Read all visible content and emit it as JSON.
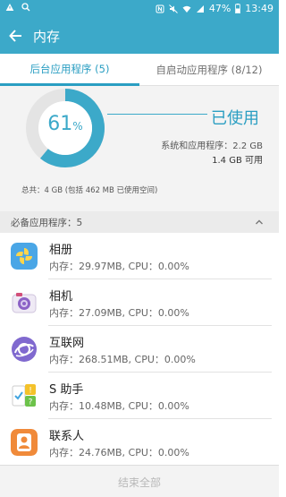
{
  "status_bar": {
    "battery": "47%",
    "time": "13:49",
    "left_icons": [
      "warning-icon",
      "search-icon"
    ],
    "right_icons": [
      "nfc-icon",
      "mute-icon",
      "wifi-icon",
      "signal-icon",
      "battery-icon"
    ]
  },
  "app_bar": {
    "title": "内存",
    "back_icon": "back-arrow-icon"
  },
  "tabs": [
    {
      "label": "后台应用程序 (5)",
      "active": true
    },
    {
      "label": "自启动应用程序 (8/12)",
      "active": false
    }
  ],
  "summary": {
    "percent_value": "61",
    "percent_sign": "%",
    "used_fraction": 0.61,
    "used_label": "已使用",
    "system_apps": "系统和应用程序：2.2 GB",
    "available": "1.4 GB 可用",
    "total": "总共：4 GB (包括 462 MB 已使用空间)"
  },
  "section": {
    "title": "必备应用程序：5",
    "chevron_icon": "chevron-up-icon"
  },
  "apps": [
    {
      "name": "相册",
      "usage": "内存：29.97MB, CPU：0.00%",
      "icon": "gallery-icon"
    },
    {
      "name": "相机",
      "usage": "内存：27.09MB, CPU：0.00%",
      "icon": "camera-icon"
    },
    {
      "name": "互联网",
      "usage": "内存：268.51MB, CPU：0.00%",
      "icon": "internet-icon"
    },
    {
      "name": "S 助手",
      "usage": "内存：10.48MB, CPU：0.00%",
      "icon": "s-assistant-icon"
    },
    {
      "name": "联系人",
      "usage": "内存：24.76MB, CPU：0.00%",
      "icon": "contacts-icon"
    }
  ],
  "bottom": {
    "end_all_label": "结束全部"
  },
  "colors": {
    "accent": "#3ca9c9",
    "tab_active": "#2a9ec2"
  }
}
